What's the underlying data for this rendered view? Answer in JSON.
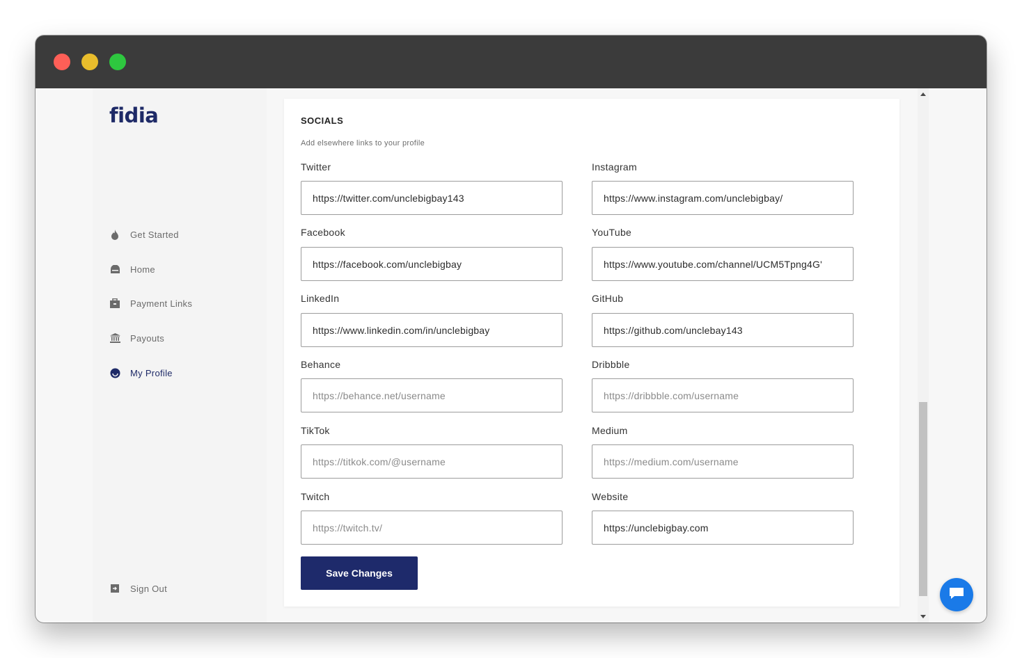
{
  "app": {
    "logo_text": "fidia"
  },
  "sidebar": {
    "items": [
      {
        "label": "Get Started",
        "icon": "flame-icon"
      },
      {
        "label": "Home",
        "icon": "home-icon"
      },
      {
        "label": "Payment Links",
        "icon": "briefcase-icon"
      },
      {
        "label": "Payouts",
        "icon": "bank-icon"
      },
      {
        "label": "My Profile",
        "icon": "profile-icon",
        "active": true
      }
    ],
    "sign_out": {
      "label": "Sign Out",
      "icon": "sign-out-icon"
    }
  },
  "socials": {
    "title": "SOCIALS",
    "subtitle": "Add elsewhere links to your profile",
    "fields": {
      "twitter": {
        "label": "Twitter",
        "value": "https://twitter.com/unclebigbay143",
        "placeholder": ""
      },
      "instagram": {
        "label": "Instagram",
        "value": "https://www.instagram.com/unclebigbay/",
        "placeholder": ""
      },
      "facebook": {
        "label": "Facebook",
        "value": "https://facebook.com/unclebigbay",
        "placeholder": ""
      },
      "youtube": {
        "label": "YouTube",
        "value": "https://www.youtube.com/channel/UCM5Tpng4G'",
        "placeholder": ""
      },
      "linkedin": {
        "label": "LinkedIn",
        "value": "https://www.linkedin.com/in/unclebigbay",
        "placeholder": ""
      },
      "github": {
        "label": "GitHub",
        "value": "https://github.com/unclebay143",
        "placeholder": ""
      },
      "behance": {
        "label": "Behance",
        "value": "",
        "placeholder": "https://behance.net/username"
      },
      "dribbble": {
        "label": "Dribbble",
        "value": "",
        "placeholder": "https://dribbble.com/username"
      },
      "tiktok": {
        "label": "TikTok",
        "value": "",
        "placeholder": "https://titkok.com/@username"
      },
      "medium": {
        "label": "Medium",
        "value": "",
        "placeholder": "https://medium.com/username"
      },
      "twitch": {
        "label": "Twitch",
        "value": "",
        "placeholder": "https://twitch.tv/"
      },
      "website": {
        "label": "Website",
        "value": "https://unclebigbay.com",
        "placeholder": ""
      }
    },
    "save_label": "Save Changes"
  },
  "colors": {
    "brand": "#1e2a67",
    "button": "#1e2a6b",
    "chat": "#1a7ae8",
    "logo_accent": "#f6a01a"
  },
  "chat_widget": {
    "icon": "chat-icon"
  }
}
